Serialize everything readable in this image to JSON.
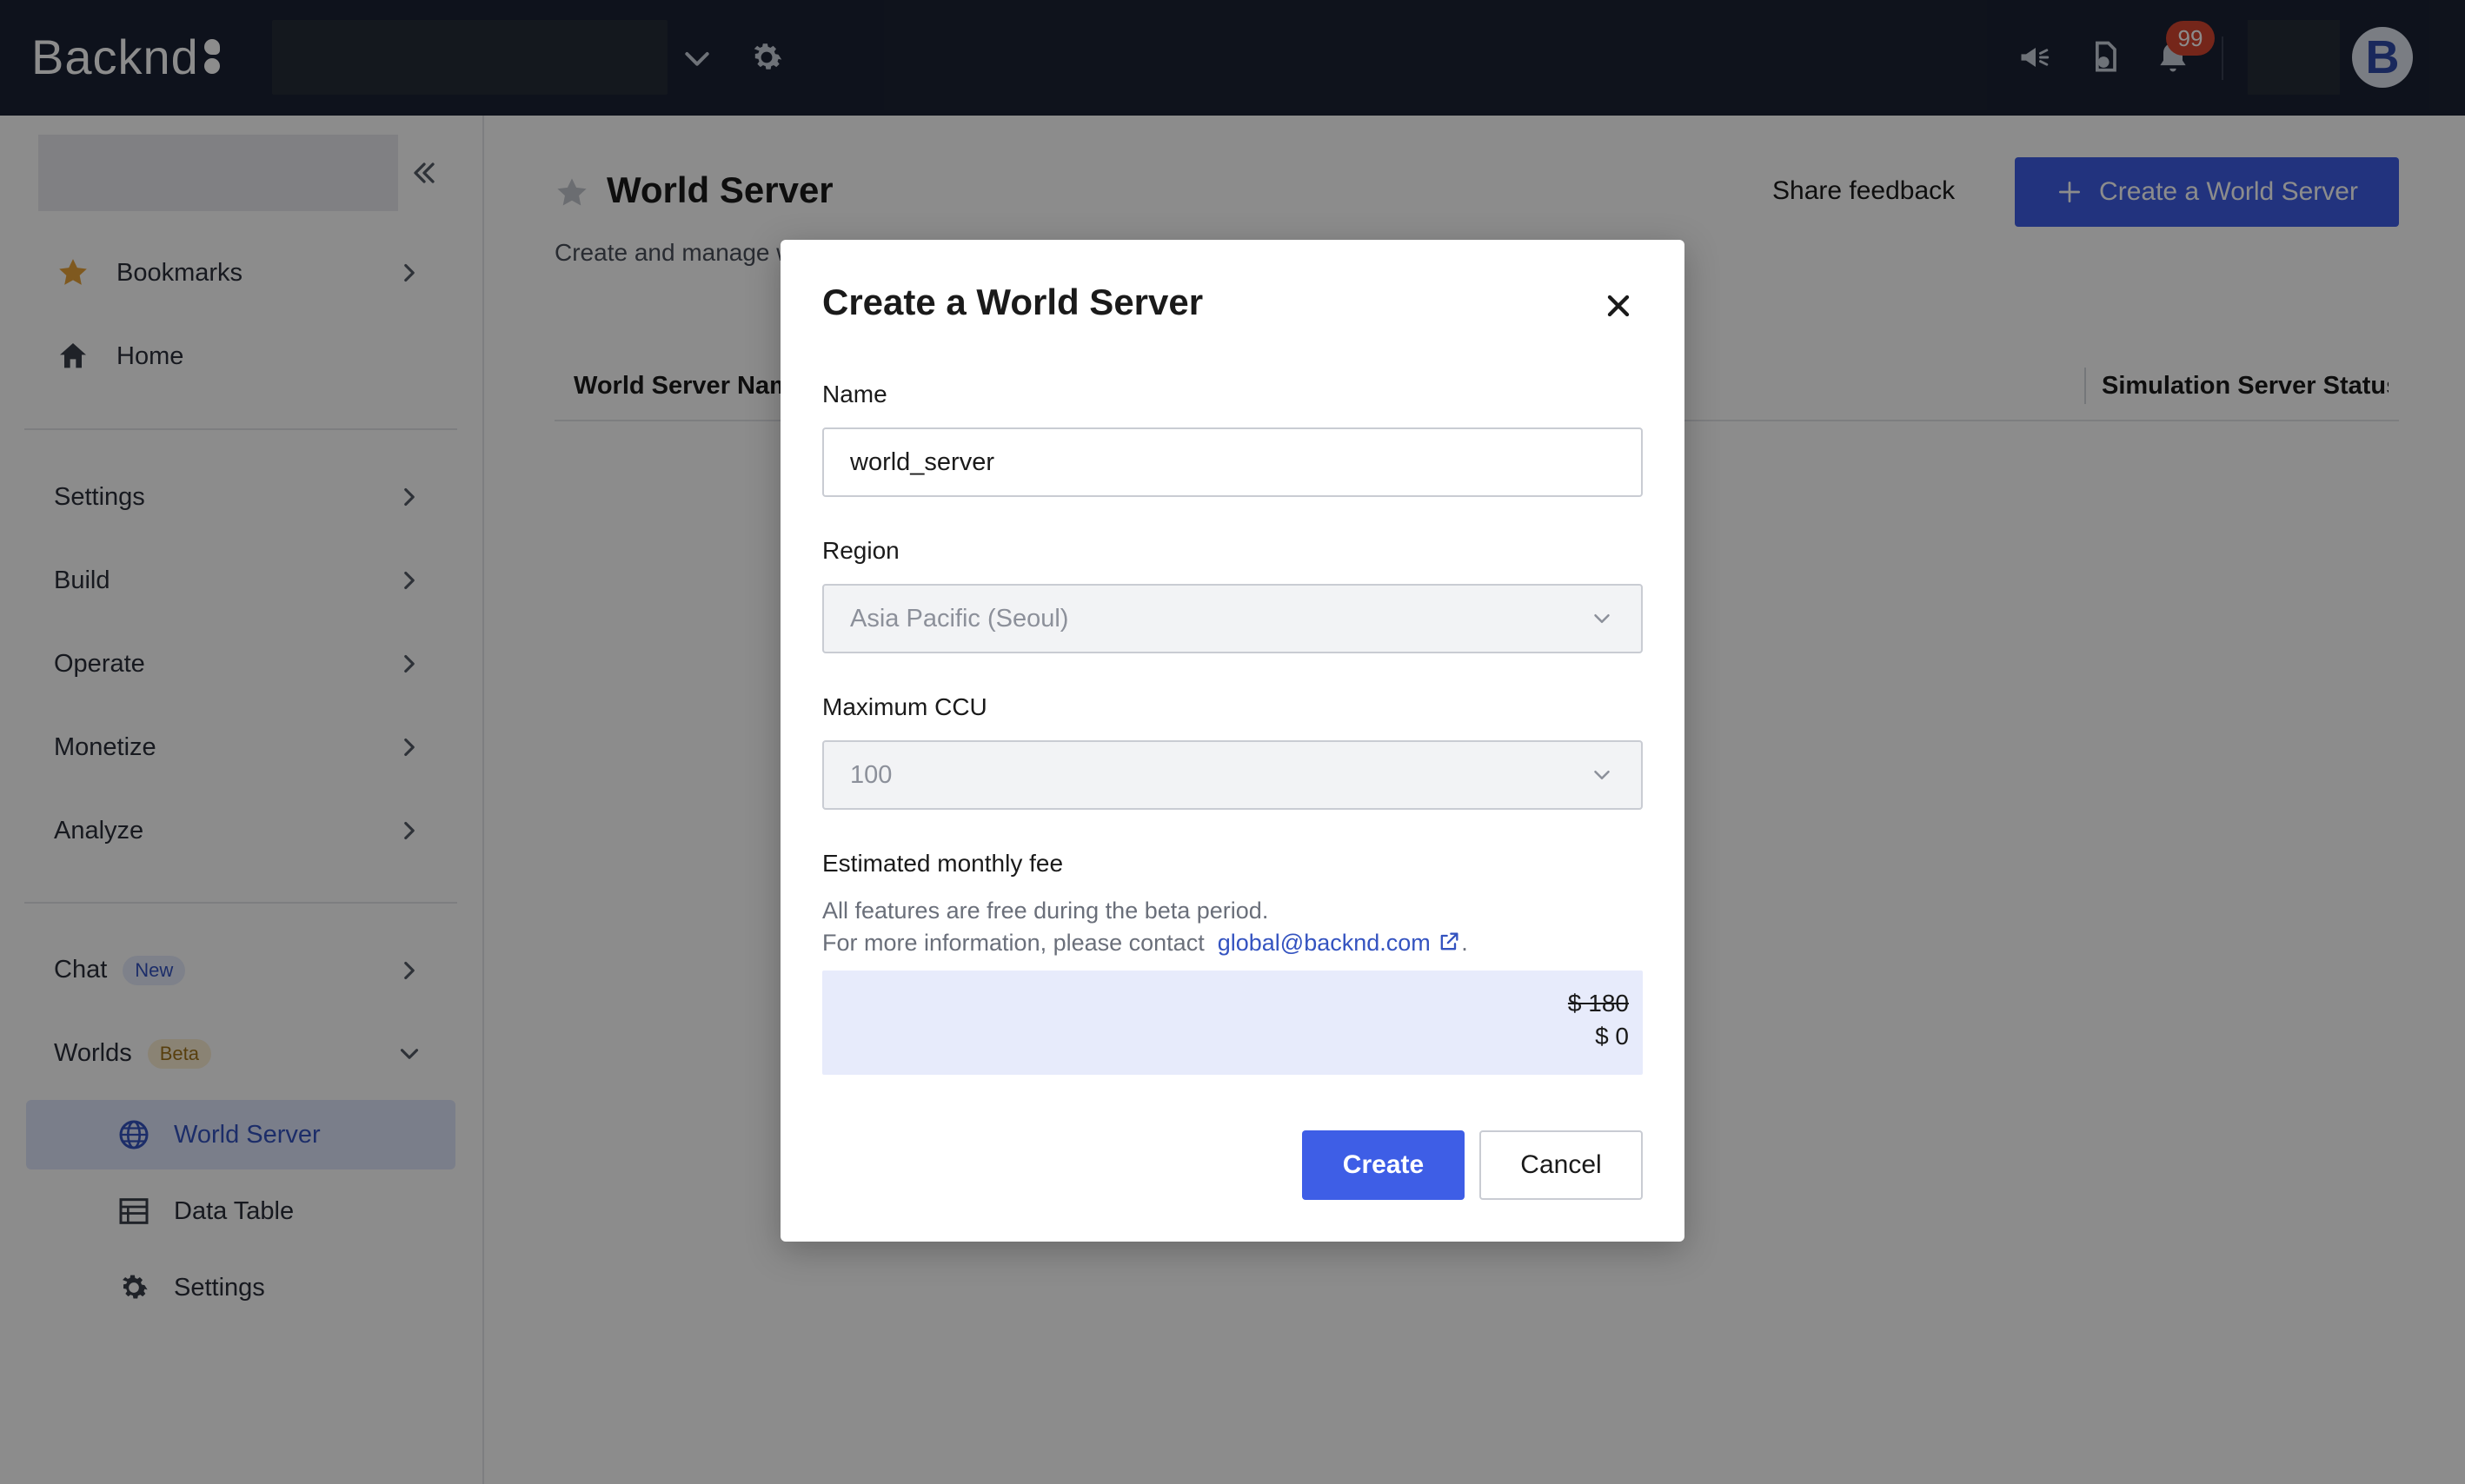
{
  "topbar": {
    "logo_text": "Backnd",
    "notification_count": "99",
    "avatar_letter": "B",
    "icons": [
      "chevron-down-icon",
      "gear-icon",
      "megaphone-icon",
      "document-icon",
      "bell-icon"
    ]
  },
  "sidebar": {
    "items": {
      "bookmarks": "Bookmarks",
      "home": "Home",
      "settings": "Settings",
      "build": "Build",
      "operate": "Operate",
      "monetize": "Monetize",
      "analyze": "Analyze",
      "chat": "Chat",
      "chat_badge": "New",
      "worlds": "Worlds",
      "worlds_badge": "Beta"
    },
    "worlds_sub": {
      "world_server": "World Server",
      "data_table": "Data Table",
      "settings": "Settings"
    }
  },
  "main": {
    "title": "World Server",
    "subtitle": "Create and manage w",
    "share_feedback": "Share feedback",
    "create_button": "Create a World Server",
    "columns": {
      "name": "World Server Name",
      "status": "Simulation Server Status"
    }
  },
  "modal": {
    "title": "Create a World Server",
    "name_label": "Name",
    "name_value": "world_server",
    "region_label": "Region",
    "region_value": "Asia Pacific (Seoul)",
    "ccu_label": "Maximum CCU",
    "ccu_value": "100",
    "fee_label": "Estimated monthly fee",
    "note_line1": "All features are free during the beta period.",
    "note_line2_prefix": "For more information, please contact",
    "contact_email": "global@backnd.com",
    "note_suffix": ".",
    "fee_original": "$ 180",
    "fee_current": "$ 0",
    "create_label": "Create",
    "cancel_label": "Cancel"
  },
  "colors": {
    "topbar_bg": "#1b2233",
    "accent": "#3e5ee6",
    "active_nav_bg": "#dfe6fb",
    "fee_box_bg": "#e7ebfb",
    "badge_red": "#d64531",
    "bookmark_star": "#e8a33a"
  }
}
